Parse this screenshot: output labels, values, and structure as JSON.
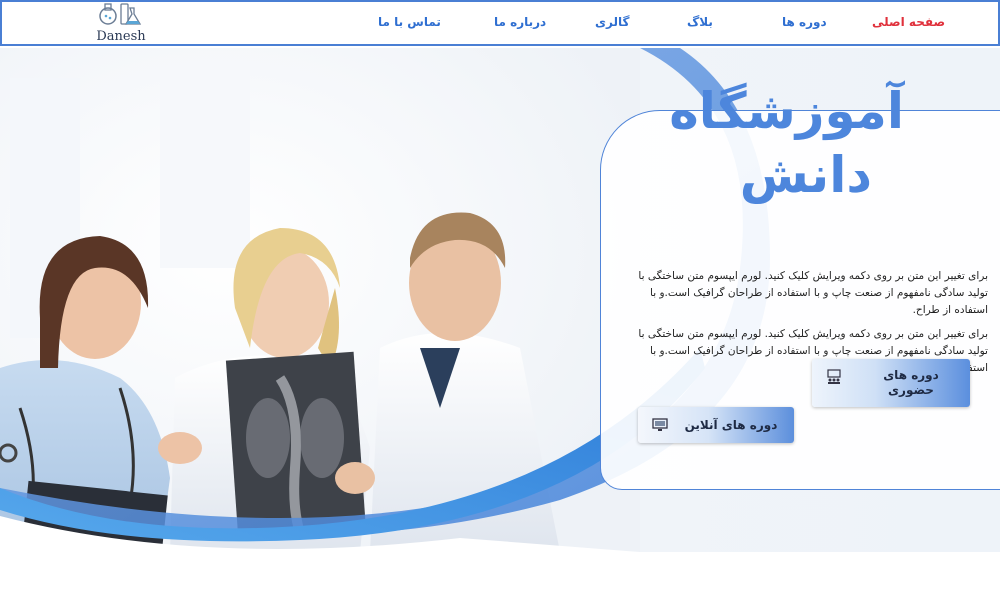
{
  "logo": {
    "text": "Danesh",
    "icon": "flask-beaker-logo"
  },
  "nav": {
    "items": [
      {
        "label": "صفحه اصلی",
        "active": true
      },
      {
        "label": "دوره ها",
        "active": false
      },
      {
        "label": "بلاگ",
        "active": false
      },
      {
        "label": "گالری",
        "active": false
      },
      {
        "label": "درباره ما",
        "active": false
      },
      {
        "label": "تماس با ما",
        "active": false
      }
    ]
  },
  "hero": {
    "title_line1": "آموزشگاه",
    "title_line2": "دانش",
    "paragraph1": "برای تغییر این متن بر روی دکمه ویرایش کلیک کنید. لورم ایپسوم متن ساختگی با تولید سادگی نامفهوم از صنعت چاپ و با استفاده از طراحان گرافیک است.و با استفاده از طراح.",
    "paragraph2": "برای تغییر این متن بر روی دکمه ویرایش کلیک کنید. لورم ایپسوم متن ساختگی با تولید سادگی نامفهوم از صنعت چاپ و با استفاده از طراحان گرافیک است.و با استفاده از طراح.",
    "btn_in_person": "دوره های حضوری",
    "btn_online": "دوره های آنلاین"
  },
  "colors": {
    "accent": "#4d86dc",
    "active_nav": "#e0313c",
    "nav": "#2f6fd1",
    "border": "#4a7fd4"
  }
}
